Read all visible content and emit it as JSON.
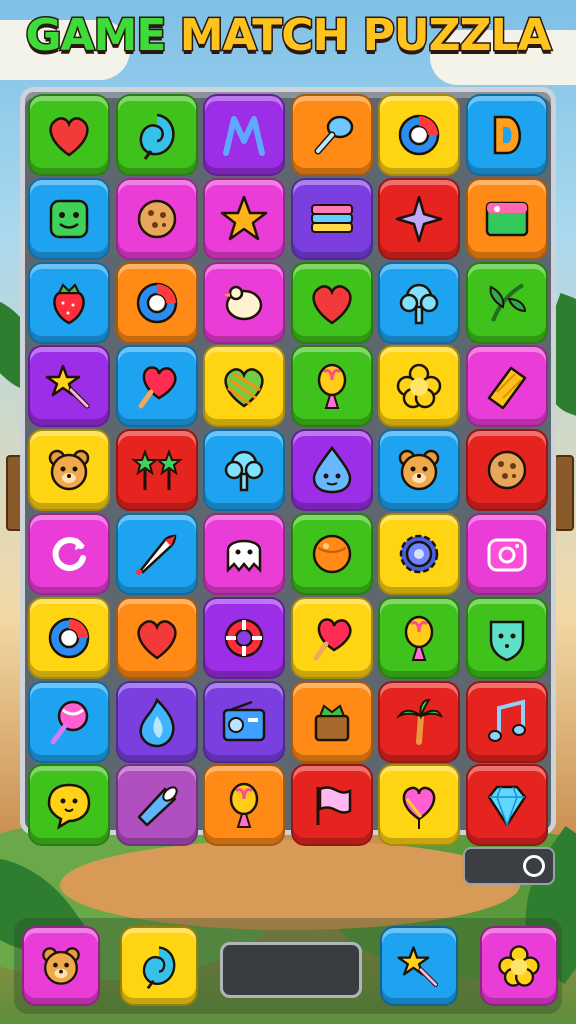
{
  "title": {
    "part1": "GAME",
    "part2": "MATCH",
    "part3": "PUZZLA"
  },
  "colors": {
    "green": "#3fc21c",
    "purple": "#9b2ee6",
    "orange": "#ff8a16",
    "yellow": "#ffd412",
    "blue": "#1ea3f0",
    "magenta": "#ea3dd8",
    "red": "#e6241f",
    "violet": "#7b3fe0",
    "mauve": "#b04fc0"
  },
  "grid": [
    [
      {
        "color": "green",
        "icon": "heart-icon"
      },
      {
        "color": "green",
        "icon": "leaf-swirl-icon"
      },
      {
        "color": "purple",
        "icon": "letter-m-icon"
      },
      {
        "color": "orange",
        "icon": "drumstick-icon"
      },
      {
        "color": "yellow",
        "icon": "ring-icon"
      },
      {
        "color": "blue",
        "icon": "letter-d-icon"
      }
    ],
    [
      {
        "color": "blue",
        "icon": "smiley-square-icon"
      },
      {
        "color": "magenta",
        "icon": "cookie-icon"
      },
      {
        "color": "magenta",
        "icon": "star-icon"
      },
      {
        "color": "violet",
        "icon": "layers-icon"
      },
      {
        "color": "red",
        "icon": "sparkle-icon"
      },
      {
        "color": "orange",
        "icon": "picture-icon"
      }
    ],
    [
      {
        "color": "blue",
        "icon": "strawberry-icon"
      },
      {
        "color": "orange",
        "icon": "ring-icon"
      },
      {
        "color": "magenta",
        "icon": "bird-icon"
      },
      {
        "color": "green",
        "icon": "heart-icon"
      },
      {
        "color": "blue",
        "icon": "tree-icon"
      },
      {
        "color": "green",
        "icon": "palm-leaf-icon"
      }
    ],
    [
      {
        "color": "purple",
        "icon": "star-wand-icon"
      },
      {
        "color": "blue",
        "icon": "heart-lollipop-icon"
      },
      {
        "color": "yellow",
        "icon": "striped-heart-icon"
      },
      {
        "color": "green",
        "icon": "balloon-icon"
      },
      {
        "color": "yellow",
        "icon": "flower-icon"
      },
      {
        "color": "magenta",
        "icon": "candy-bar-icon"
      }
    ],
    [
      {
        "color": "yellow",
        "icon": "bear-icon"
      },
      {
        "color": "red",
        "icon": "twin-stars-icon"
      },
      {
        "color": "blue",
        "icon": "tree-icon"
      },
      {
        "color": "purple",
        "icon": "droplet-face-icon"
      },
      {
        "color": "blue",
        "icon": "bear-icon"
      },
      {
        "color": "red",
        "icon": "cookie-icon"
      }
    ],
    [
      {
        "color": "magenta",
        "icon": "refresh-icon"
      },
      {
        "color": "blue",
        "icon": "rocket-icon"
      },
      {
        "color": "magenta",
        "icon": "ghost-icon"
      },
      {
        "color": "green",
        "icon": "ball-icon"
      },
      {
        "color": "yellow",
        "icon": "gear-icon"
      },
      {
        "color": "magenta",
        "icon": "camera-icon"
      }
    ],
    [
      {
        "color": "yellow",
        "icon": "ring-icon"
      },
      {
        "color": "orange",
        "icon": "heart-icon"
      },
      {
        "color": "purple",
        "icon": "lifebuoy-icon"
      },
      {
        "color": "yellow",
        "icon": "heart-lollipop-icon"
      },
      {
        "color": "green",
        "icon": "balloon-icon"
      },
      {
        "color": "green",
        "icon": "shield-face-icon"
      }
    ],
    [
      {
        "color": "blue",
        "icon": "lollipop-icon"
      },
      {
        "color": "violet",
        "icon": "flame-icon"
      },
      {
        "color": "violet",
        "icon": "radio-icon"
      },
      {
        "color": "orange",
        "icon": "cake-icon"
      },
      {
        "color": "red",
        "icon": "palm-tree-icon"
      },
      {
        "color": "red",
        "icon": "music-note-icon"
      }
    ],
    [
      {
        "color": "green",
        "icon": "chat-face-icon"
      },
      {
        "color": "mauve",
        "icon": "megaphone-icon"
      },
      {
        "color": "orange",
        "icon": "balloon-icon"
      },
      {
        "color": "red",
        "icon": "flag-icon"
      },
      {
        "color": "yellow",
        "icon": "heart-balloon-icon"
      },
      {
        "color": "red",
        "icon": "gem-icon"
      }
    ]
  ],
  "toggle": {
    "state": "on"
  },
  "bottom_buttons": [
    {
      "color": "magenta",
      "icon": "bear-icon"
    },
    {
      "color": "yellow",
      "icon": "leaf-swirl-icon"
    },
    {
      "color": "blue",
      "icon": "star-wand-icon"
    },
    {
      "color": "magenta",
      "icon": "flower-icon"
    }
  ]
}
